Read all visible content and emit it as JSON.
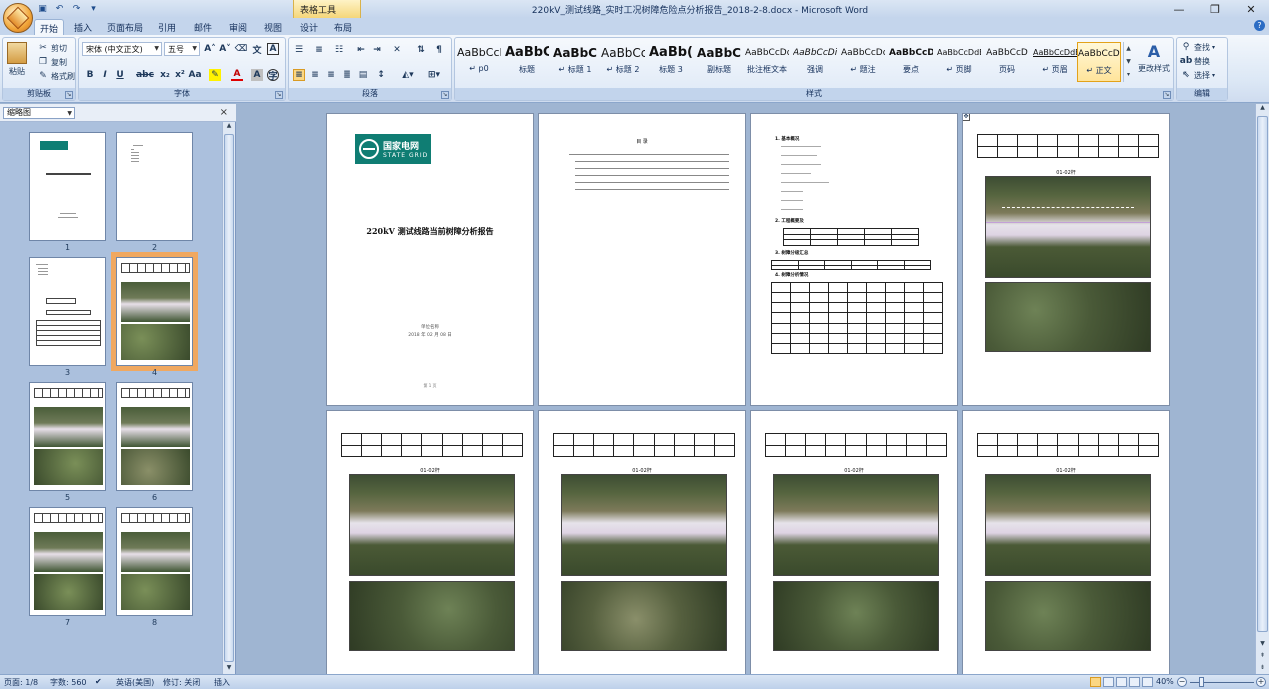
{
  "window": {
    "title": "220kV_测试线路_实时工况树障危险点分析报告_2018-2-8.docx - Microsoft Word",
    "context_tab": "表格工具",
    "controls": [
      "—",
      "❐",
      "✕"
    ]
  },
  "quick_access": [
    "save-icon",
    "undo-icon",
    "redo-icon",
    "customize-icon"
  ],
  "tabs": [
    {
      "label": "开始",
      "active": true
    },
    {
      "label": "插入"
    },
    {
      "label": "页面布局"
    },
    {
      "label": "引用"
    },
    {
      "label": "邮件"
    },
    {
      "label": "审阅"
    },
    {
      "label": "视图"
    },
    {
      "label": "设计"
    },
    {
      "label": "布局"
    }
  ],
  "ribbon": {
    "clipboard": {
      "label": "剪贴板",
      "paste": "粘贴",
      "cut": "剪切",
      "copy": "复制",
      "format_painter": "格式刷"
    },
    "font": {
      "label": "字体",
      "font_name": "宋体 (中文正文)",
      "font_size": "五号"
    },
    "paragraph": {
      "label": "段落"
    },
    "styles": {
      "label": "样式",
      "tiles": [
        {
          "sample": "AaBbCcDc",
          "name": "↵ p0"
        },
        {
          "sample": "AaBbC",
          "name": "标题"
        },
        {
          "sample": "AaBbC",
          "name": "↵ 标题 1"
        },
        {
          "sample": "AaBbCc",
          "name": "↵ 标题 2"
        },
        {
          "sample": "AaBb(",
          "name": "标题 3"
        },
        {
          "sample": "AaBbC",
          "name": "副标题"
        },
        {
          "sample": "AaBbCcDd",
          "name": "批注框文本"
        },
        {
          "sample": "AaBbCcDi",
          "name": "强调"
        },
        {
          "sample": "AaBbCcDd",
          "name": "↵ 题注"
        },
        {
          "sample": "AaBbCcD",
          "name": "要点"
        },
        {
          "sample": "AaBbCcDdE",
          "name": "↵ 页脚"
        },
        {
          "sample": "AaBbCcD",
          "name": "页码"
        },
        {
          "sample": "AaBbCcDdE",
          "name": "↵ 页眉"
        },
        {
          "sample": "AaBbCcDc",
          "name": "↵ 正文",
          "selected": true
        }
      ],
      "change_styles": "更改样式"
    },
    "editing": {
      "label": "编辑",
      "find": "查找",
      "replace": "替换",
      "select": "选择"
    }
  },
  "thumbnails": {
    "view_select": "缩略图",
    "pages": [
      "1",
      "2",
      "3",
      "4",
      "5",
      "6",
      "7",
      "8"
    ],
    "current": "4"
  },
  "document": {
    "cover": {
      "brand_cn": "国家电网",
      "brand_en": "STATE GRID",
      "title": "220kV 测试线路当前树障分析报告",
      "company": "单位名称",
      "date": "2018 年 02 月 08 日",
      "page_no": "第 1 页"
    },
    "toc": {
      "heading": "目 录"
    },
    "page3": {
      "s1": "1. 基本概况",
      "s2": "2. 工程概要及",
      "s3": "3. 树障分级汇总",
      "s4": "4. 树障分析情况"
    },
    "section_label": "01-02杆"
  },
  "status": {
    "page": "页面: 1/8",
    "words": "字数: 560",
    "language": "英语(美国)",
    "track": "修订: 关闭",
    "insert": "插入",
    "zoom": "40%"
  }
}
